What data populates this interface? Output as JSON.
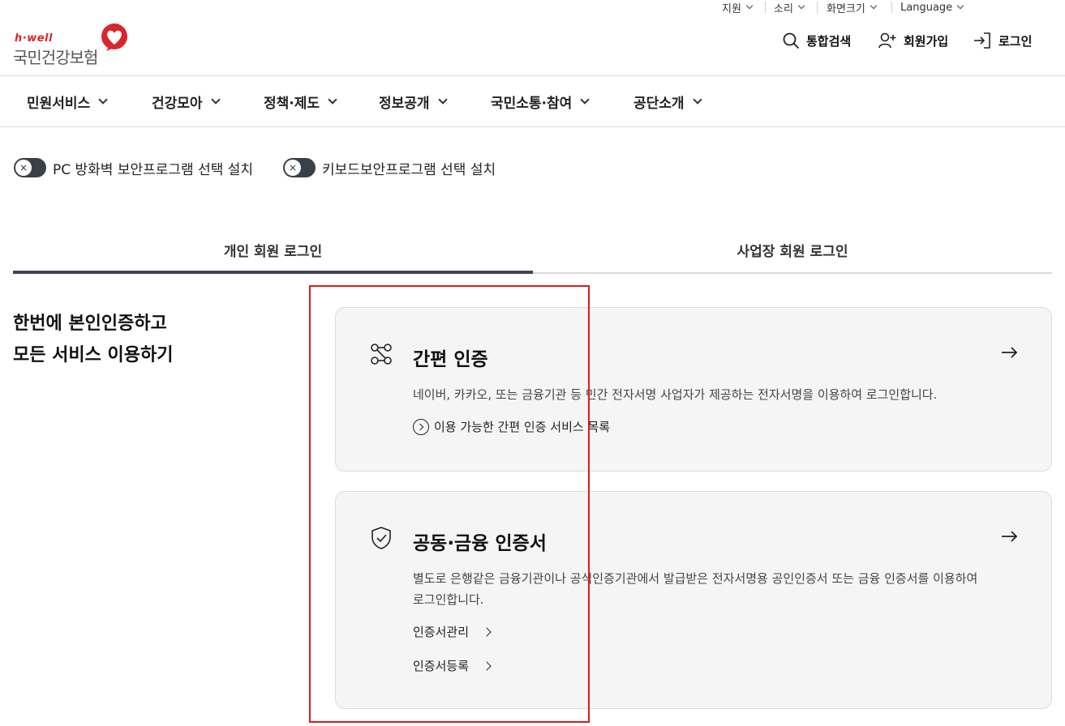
{
  "utility": {
    "support": "지원",
    "sound": "소리",
    "zoom": "화면크기",
    "language": "Language"
  },
  "logo": {
    "brand": "h·well",
    "name": "국민건강보험"
  },
  "header": {
    "search": "통합검색",
    "signup": "회원가입",
    "login": "로그인"
  },
  "gnb": [
    {
      "label": "민원서비스"
    },
    {
      "label": "건강모아"
    },
    {
      "label": "정책·제도"
    },
    {
      "label": "정보공개"
    },
    {
      "label": "국민소통·참여"
    },
    {
      "label": "공단소개"
    }
  ],
  "toggles": [
    {
      "label": "PC 방화벽 보안프로그램 선택 설치",
      "state": "off"
    },
    {
      "label": "키보드보안프로그램 선택 설치",
      "state": "off"
    }
  ],
  "tabs": [
    {
      "label": "개인 회원 로그인",
      "active": true
    },
    {
      "label": "사업장 회원 로그인",
      "active": false
    }
  ],
  "intro": {
    "line1": "한번에 본인인증하고",
    "line2": "모든 서비스 이용하기"
  },
  "cards": {
    "simple": {
      "icon": "flow-icon",
      "title": "간편 인증",
      "desc": "네이버, 카카오, 또는 금융기관 등 민간 전자서명 사업자가 제공하는 전자서명을 이용하여 로그인합니다.",
      "link": "이용 가능한 간편 인증 서비스 목록"
    },
    "cert": {
      "icon": "shield-check-icon",
      "title": "공동·금융 인증서",
      "desc": "별도로 은행같은 금융기관이나 공식인증기관에서 발급받은 전자서명용 공인인증서 또는 금융 인증서를 이용하여 로그인합니다.",
      "links": [
        "인증서관리",
        "인증서등록"
      ]
    }
  },
  "colors": {
    "brand_red": "#d9252b",
    "tab_active": "#3f4556",
    "toggle_bg": "#3b3f4a",
    "card_bg": "#f5f5f5",
    "highlight_box": "#e11a1a"
  }
}
